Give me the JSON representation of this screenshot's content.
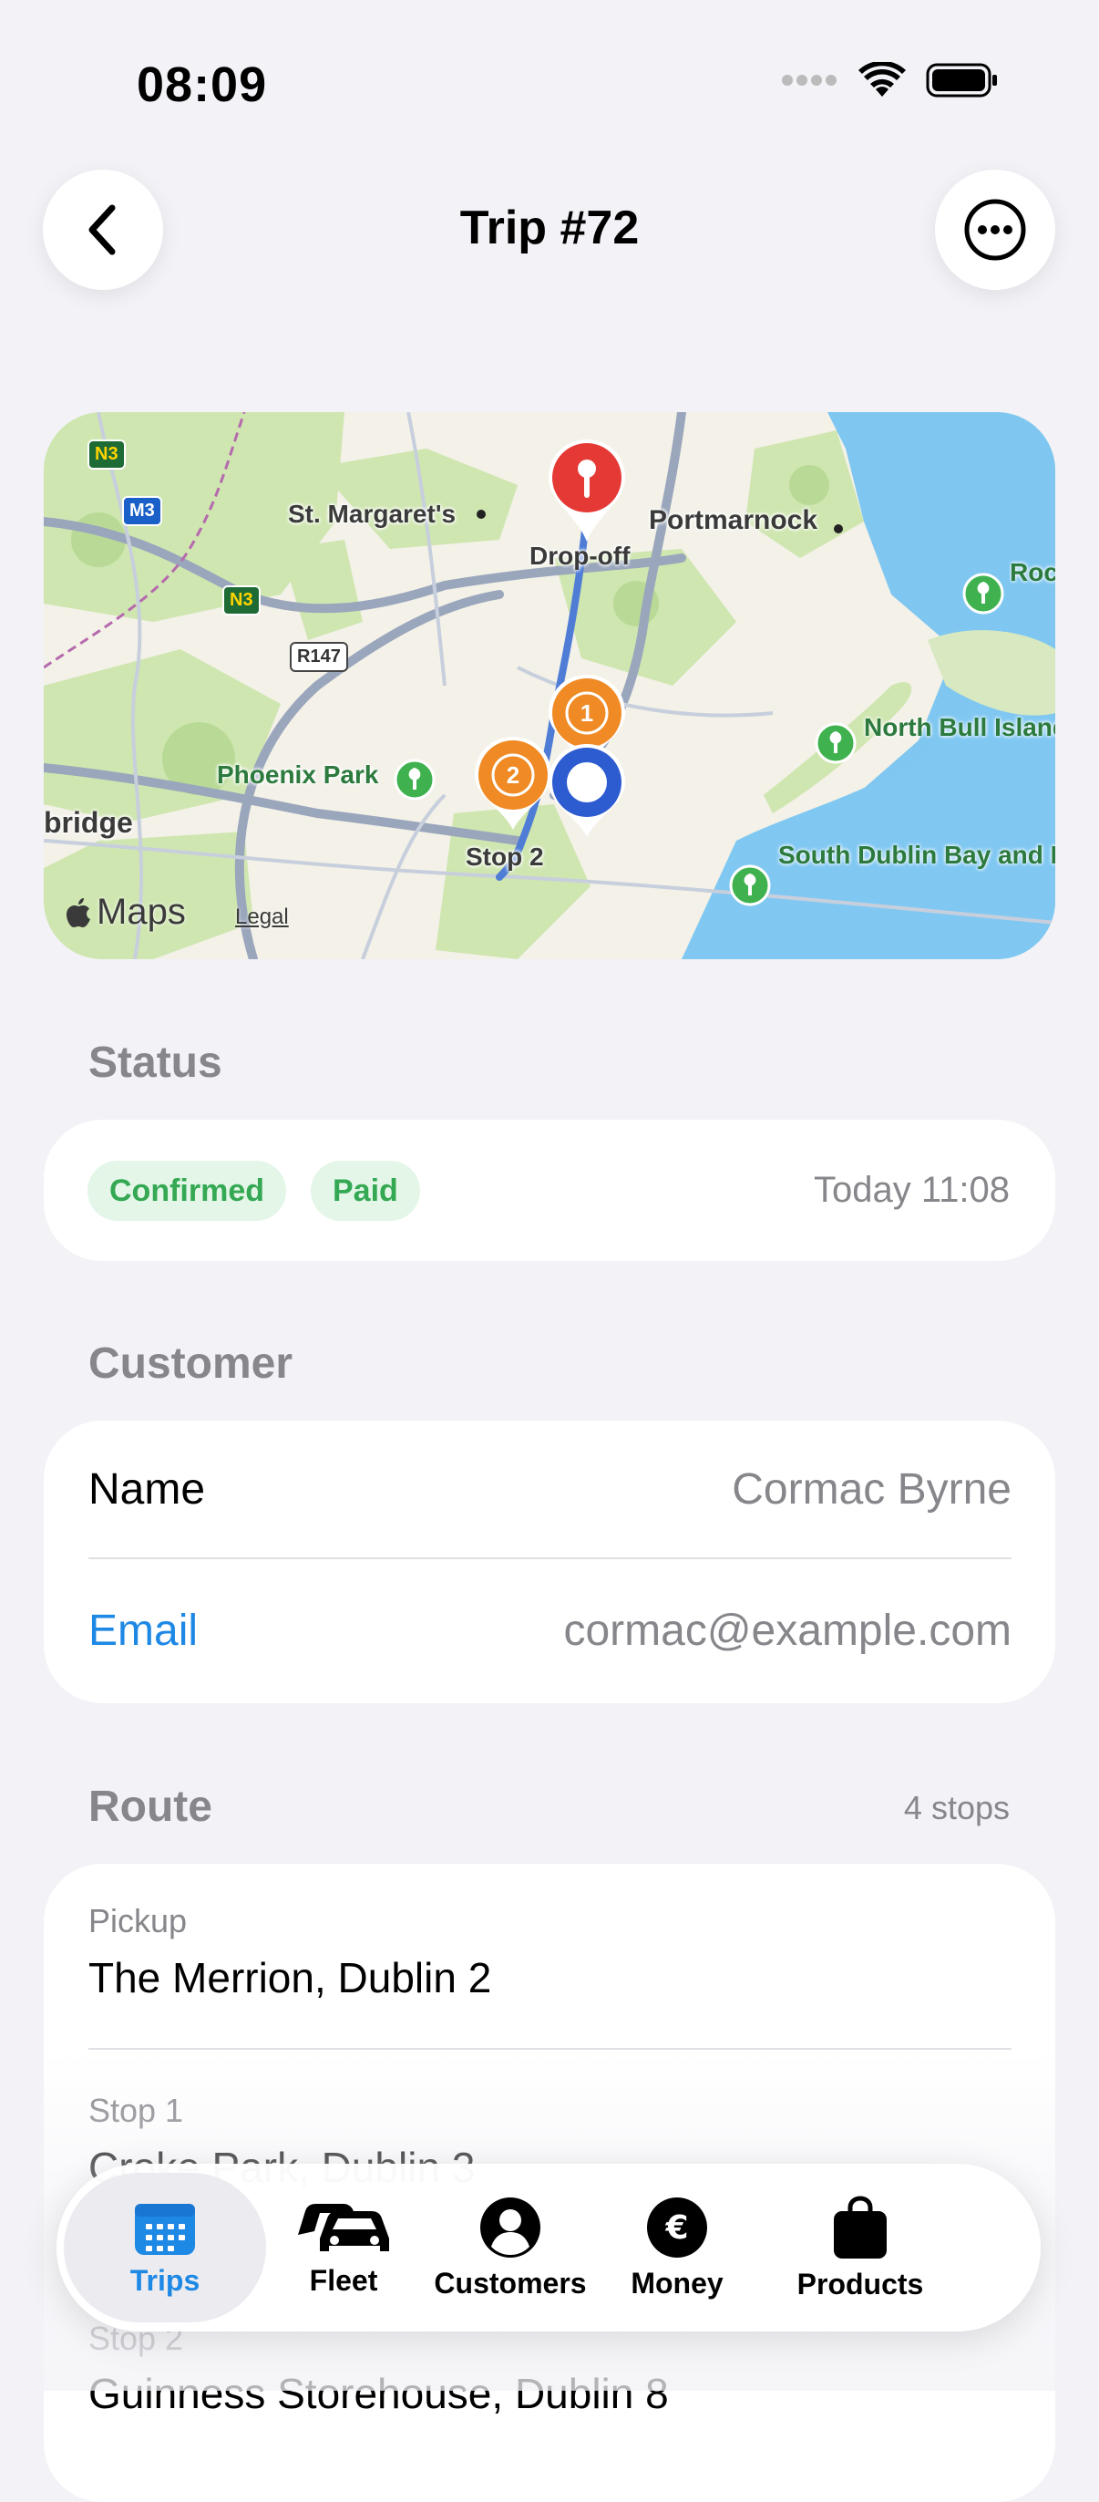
{
  "status_bar": {
    "time": "08:09"
  },
  "nav": {
    "title": "Trip #72"
  },
  "map": {
    "labels": {
      "st_margarets": "St. Margaret's",
      "portmarnock": "Portmarnock",
      "dropoff": "Drop-off",
      "phoenix_park": "Phoenix Park",
      "bridge": "bridge",
      "stop2": "Stop 2",
      "north_bull": "North Bull Island SPA",
      "south_dublin": "South Dublin Bay and River Tolka Estuary SPA",
      "rock_to": "Rock to D Isla",
      "maps": "Maps",
      "legal": "Legal",
      "m3": "M3",
      "n3a": "N3",
      "n3b": "N3",
      "r147": "R147",
      "pin1": "1",
      "pin2": "2"
    }
  },
  "status_section": {
    "title": "Status",
    "badges": [
      "Confirmed",
      "Paid"
    ],
    "time": "Today 11:08"
  },
  "customer_section": {
    "title": "Customer",
    "name_label": "Name",
    "name_value": "Cormac Byrne",
    "email_label": "Email",
    "email_value": "cormac@example.com"
  },
  "route_section": {
    "title": "Route",
    "count": "4 stops",
    "stops": [
      {
        "label": "Pickup",
        "value": "The Merrion, Dublin 2"
      },
      {
        "label": "Stop 1",
        "value": "Croke Park, Dublin 3"
      },
      {
        "label": "Stop 2",
        "value": "Guinness Storehouse, Dublin 8"
      }
    ]
  },
  "tabbar": {
    "items": [
      {
        "label": "Trips",
        "active": true
      },
      {
        "label": "Fleet"
      },
      {
        "label": "Customers"
      },
      {
        "label": "Money"
      },
      {
        "label": "Products"
      }
    ]
  },
  "colors": {
    "accent": "#1E88E5",
    "badge_green": "#34A853",
    "dropoff_red": "#E53935",
    "stop_orange": "#F08A24",
    "pickup_blue": "#2D5BD0"
  }
}
